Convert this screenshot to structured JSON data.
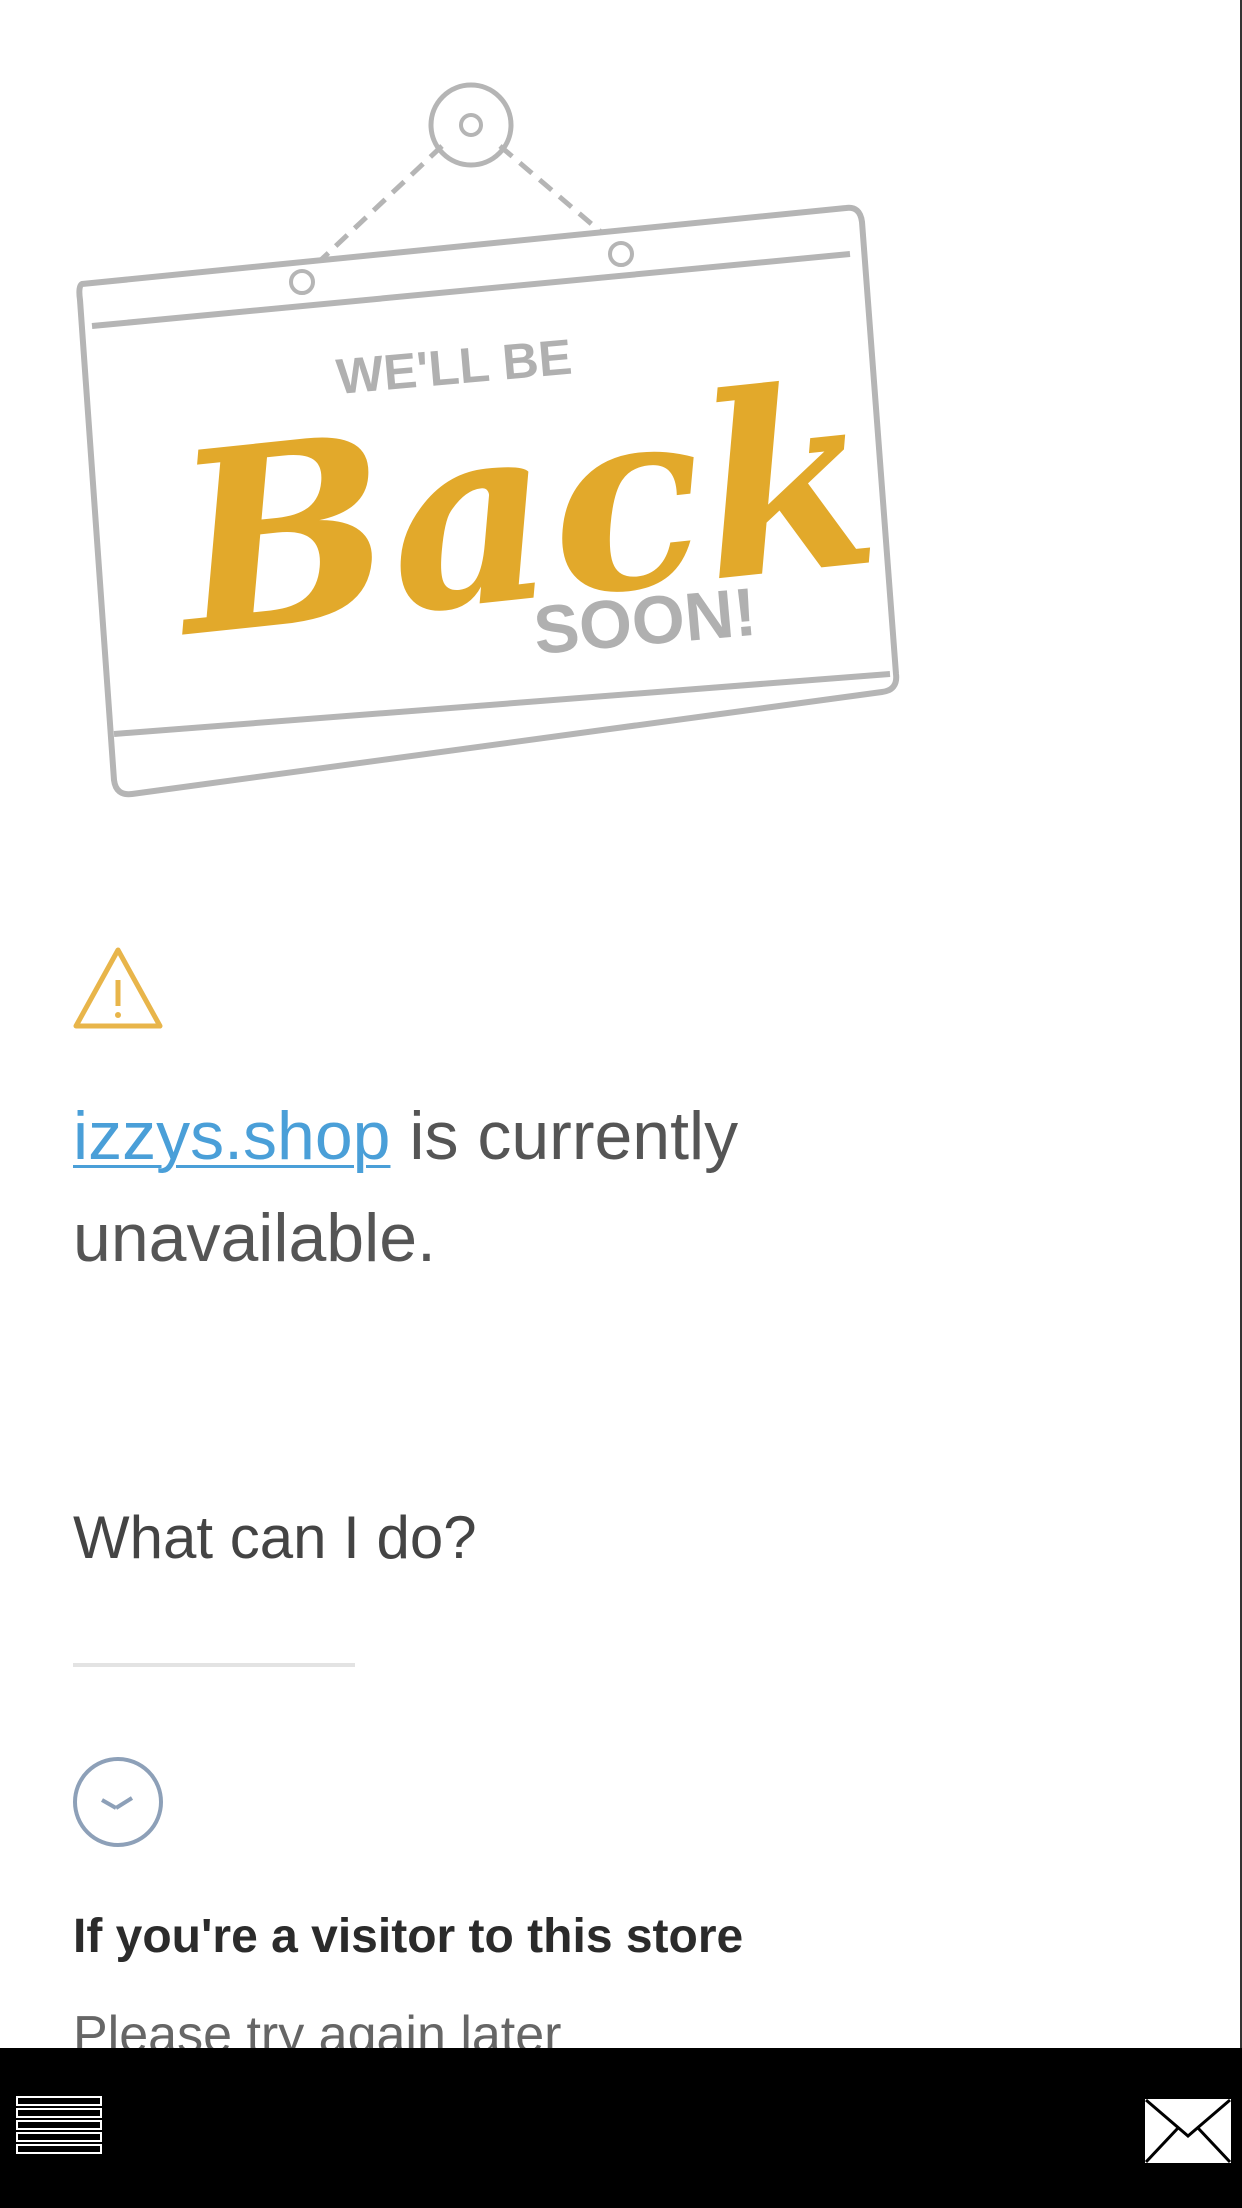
{
  "sign": {
    "line1": "WE'LL BE",
    "line2": "Back",
    "line3": "SOON!"
  },
  "status": {
    "store_link": "izzys.shop",
    "message": " is currently unavailable."
  },
  "help": {
    "question": "What can I do?",
    "visitor_title": "If you're a visitor to this store",
    "visitor_text": "Please try again later"
  },
  "icons": {
    "warning": "warning-icon",
    "clock": "clock-icon",
    "menu": "menu-icon",
    "mail": "mail-icon"
  },
  "colors": {
    "accent_gold": "#e2a92b",
    "sign_gray": "#a8a8a8",
    "link_blue": "#4a9fd8",
    "text_gray": "#555555"
  }
}
